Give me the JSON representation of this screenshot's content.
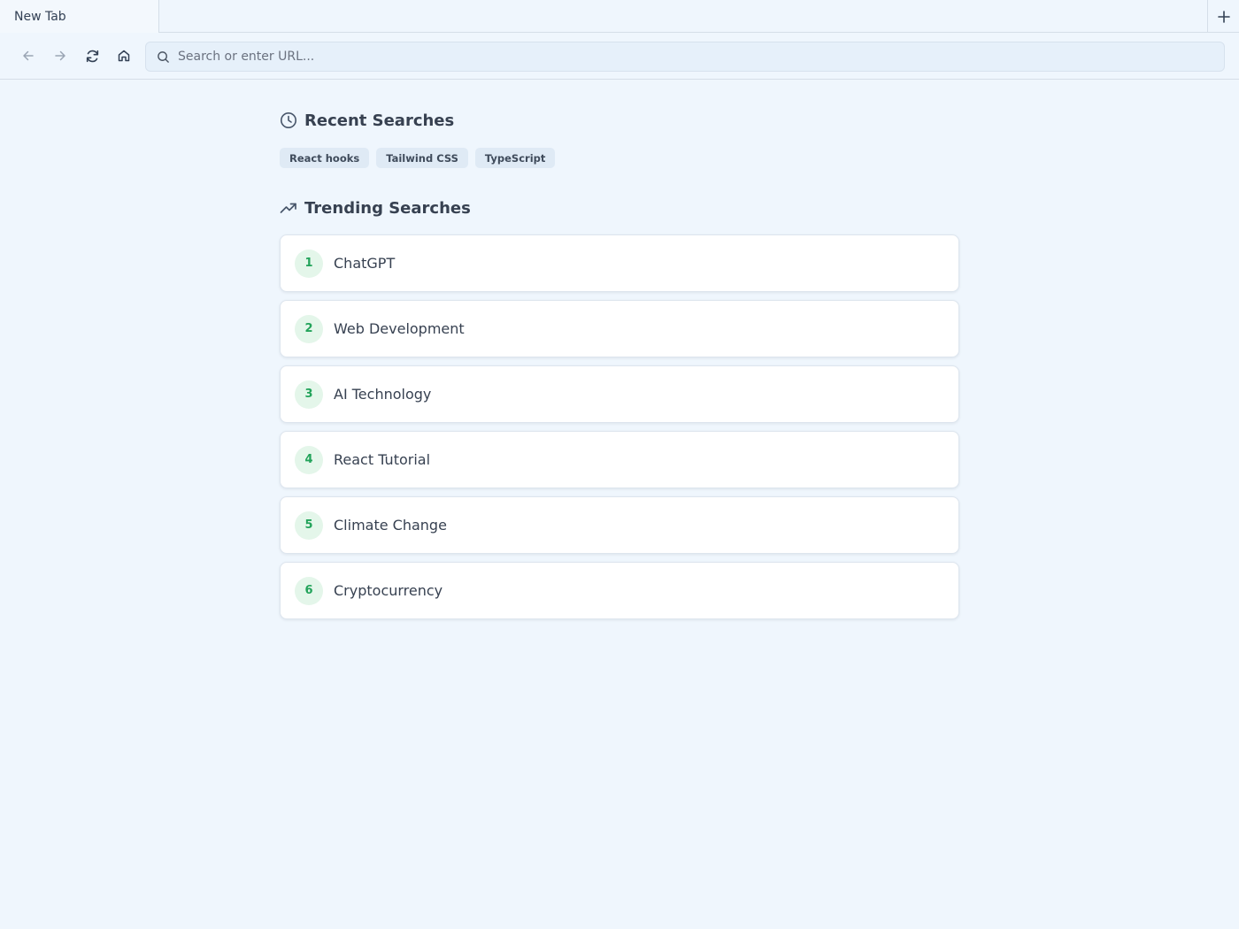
{
  "tabs": [
    {
      "label": "New Tab"
    }
  ],
  "urlbar": {
    "placeholder": "Search or enter URL..."
  },
  "recent": {
    "title": "Recent Searches",
    "items": [
      "React hooks",
      "Tailwind CSS",
      "TypeScript"
    ]
  },
  "trending": {
    "title": "Trending Searches",
    "items": [
      {
        "rank": "1",
        "label": "ChatGPT"
      },
      {
        "rank": "2",
        "label": "Web Development"
      },
      {
        "rank": "3",
        "label": "AI Technology"
      },
      {
        "rank": "4",
        "label": "React Tutorial"
      },
      {
        "rank": "5",
        "label": "Climate Change"
      },
      {
        "rank": "6",
        "label": "Cryptocurrency"
      }
    ]
  },
  "colors": {
    "accent_green": "#22a35a",
    "background": "#eff6fd"
  },
  "icons": [
    "plus-icon",
    "arrow-left-icon",
    "arrow-right-icon",
    "refresh-icon",
    "home-icon",
    "search-icon",
    "clock-icon",
    "trending-up-icon"
  ]
}
